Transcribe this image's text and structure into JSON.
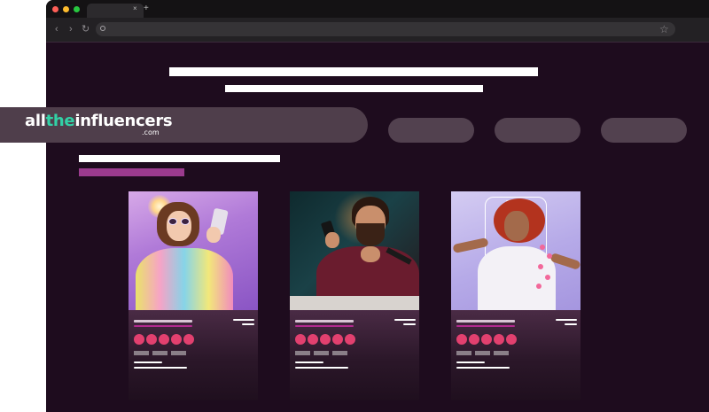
{
  "browser": {
    "tab_close_glyph": "×",
    "new_tab_glyph": "+",
    "back_glyph": "‹",
    "forward_glyph": "›",
    "reload_glyph": "↻",
    "bookmark_glyph": "☆",
    "traffic_lights": [
      "#ff5f57",
      "#febc2e",
      "#28c840"
    ]
  },
  "logo": {
    "part_all": "all",
    "part_the": "the",
    "part_influencers": "influencers",
    "suffix": ".com",
    "accent_color": "#32d1a6"
  },
  "colors": {
    "page_background": "#1e0c1e",
    "accent_bar": "#9b3b8e",
    "heart": "#e2406f",
    "pill": "#52414f"
  },
  "cards": [
    {
      "photo": "woman with heart sunglasses in colorful sweater holding phone",
      "rating_hearts": 5
    },
    {
      "photo": "bearded man gesturing at phone with microphone",
      "rating_hearts": 5
    },
    {
      "photo": "curly-haired woman smiling inside phone frame with hearts",
      "rating_hearts": 5
    }
  ]
}
